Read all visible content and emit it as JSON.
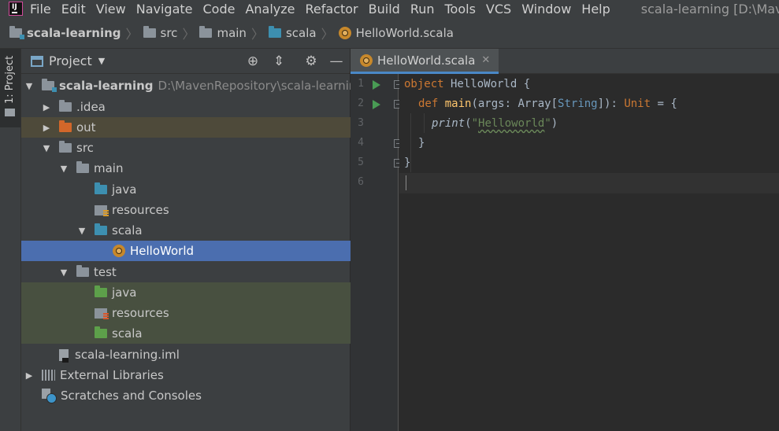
{
  "menu": {
    "items": [
      "File",
      "Edit",
      "View",
      "Navigate",
      "Code",
      "Analyze",
      "Refactor",
      "Build",
      "Run",
      "Tools",
      "VCS",
      "Window",
      "Help"
    ],
    "window_title": "scala-learning [D:\\Maven"
  },
  "breadcrumb": {
    "items": [
      "scala-learning",
      "src",
      "main",
      "scala",
      "HelloWorld.scala"
    ]
  },
  "tool_strip": {
    "label": "1: Project"
  },
  "project_panel": {
    "title": "Project",
    "dropdown_icon": "triangle-down-icon",
    "header_icons": [
      "locate-icon",
      "collapse-icon",
      "gear-icon",
      "minimize-icon"
    ],
    "tree": [
      {
        "label": "scala-learning",
        "path": "D:\\MavenRepository\\scala-learning",
        "expanded": true
      },
      {
        "label": ".idea",
        "expanded": false
      },
      {
        "label": "out",
        "expanded": false,
        "status": "excluded"
      },
      {
        "label": "src",
        "expanded": true
      },
      {
        "label": "main",
        "expanded": true
      },
      {
        "label": "java"
      },
      {
        "label": "resources"
      },
      {
        "label": "scala",
        "expanded": true
      },
      {
        "label": "HelloWorld",
        "selected": true
      },
      {
        "label": "test",
        "expanded": true
      },
      {
        "label": "java"
      },
      {
        "label": "resources"
      },
      {
        "label": "scala"
      },
      {
        "label": "scala-learning.iml"
      },
      {
        "label": "External Libraries",
        "expanded": false
      },
      {
        "label": "Scratches and Consoles"
      }
    ]
  },
  "editor": {
    "tab_label": "HelloWorld.scala",
    "line_numbers": [
      "1",
      "2",
      "3",
      "4",
      "5",
      "6"
    ],
    "code": {
      "l1_kw": "object",
      "l1_rest": " HelloWorld {",
      "l2_kw": "def",
      "l2_fn": "main",
      "l2_args": "(args: Array[",
      "l2_type": "String",
      "l2_mid": "]): ",
      "l2_unit": "Unit",
      "l2_end": " = {",
      "l3_call": "print",
      "l3_open": "(",
      "l3_q1": "\"",
      "l3_str": "Helloworld",
      "l3_q2": "\"",
      "l3_close": ")",
      "l4": "}",
      "l5": "}"
    }
  },
  "colors": {
    "selection": "#4b6eaf",
    "keyword": "#cc7832",
    "string": "#6a8759",
    "run_marker": "#499c54"
  }
}
